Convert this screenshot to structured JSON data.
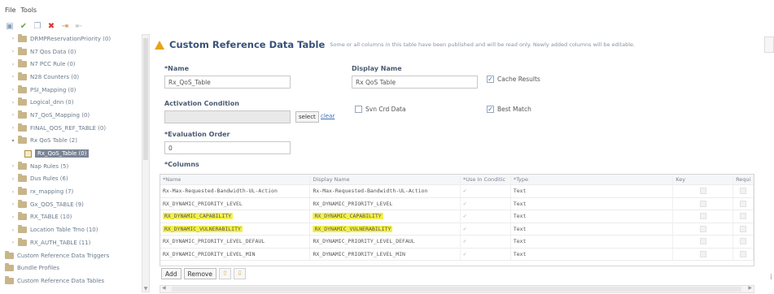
{
  "menu": [
    "File",
    "Tools"
  ],
  "toolbar": {
    "icons": [
      "save-icon",
      "check-icon",
      "copy-icon",
      "delete-icon",
      "export-icon",
      "import-icon"
    ]
  },
  "tree": [
    {
      "label": "DRMPReservationPriority (0)",
      "expanded": false
    },
    {
      "label": "N7 Qos Data (0)",
      "expanded": false
    },
    {
      "label": "N7 PCC Rule (0)",
      "expanded": false
    },
    {
      "label": "N28 Counters (0)",
      "expanded": false
    },
    {
      "label": "PSI_Mapping (0)",
      "expanded": false
    },
    {
      "label": "Logical_dnn (0)",
      "expanded": false
    },
    {
      "label": "N7_QoS_Mapping (0)",
      "expanded": false
    },
    {
      "label": "FINAL_QOS_REF_TABLE (0)",
      "expanded": false
    },
    {
      "label": "Rx QoS Table (2)",
      "expanded": true
    },
    {
      "label": "Rx_QoS_Table (0)",
      "selected": true,
      "child": true
    },
    {
      "label": "Nap Rules (5)",
      "expanded": false
    },
    {
      "label": "Dus Rules (6)",
      "expanded": false
    },
    {
      "label": "rx_mapping (7)",
      "expanded": false
    },
    {
      "label": "Gx_QOS_TABLE (9)",
      "expanded": false
    },
    {
      "label": "RX_TABLE (10)",
      "expanded": false
    },
    {
      "label": "Location Table Trno (10)",
      "expanded": false
    },
    {
      "label": "RX_AUTH_TABLE (11)",
      "expanded": false
    },
    {
      "label": "Custom Reference Data Triggers",
      "root": true
    },
    {
      "label": "Bundle Profiles",
      "root": true
    },
    {
      "label": "Custom Reference Data Tables",
      "root": true
    }
  ],
  "header": {
    "title": "Custom Reference Data Table",
    "notice": "Some or all columns in this table have been published and will be read only.  Newly added columns will be editable."
  },
  "form": {
    "name_label": "*Name",
    "name_value": "Rx_QoS_Table",
    "display_name_label": "Display Name",
    "display_name_value": "Rx QoS Table",
    "cache_results_label": "Cache Results",
    "cache_results_checked": true,
    "activation_label": "Activation Condition",
    "activation_value": "",
    "select_label": "select",
    "clear_label": "clear",
    "svn_label": "Svn Crd Data",
    "svn_checked": false,
    "best_match_label": "Best Match",
    "best_match_checked": true,
    "eval_label": "*Evaluation Order",
    "eval_value": "0",
    "columns_label": "*Columns"
  },
  "grid": {
    "headers": [
      "*Name",
      "Display Name",
      "*Use In Conditic",
      "*Type",
      "Key",
      "Requi"
    ],
    "rows": [
      {
        "name": "Rx-Max-Requested-Bandwidth-UL-Action",
        "display": "Rx-Max-Requested-Bandwidth-UL-Action",
        "use": "✓",
        "type": "Text",
        "highlight": false
      },
      {
        "name": "RX_DYNAMIC_PRIORITY_LEVEL",
        "display": "RX_DYNAMIC_PRIORITY_LEVEL",
        "use": "✓",
        "type": "Text",
        "highlight": false
      },
      {
        "name": "RX_DYNAMIC_CAPABILITY",
        "display": "RX_DYNAMIC_CAPABILITY",
        "use": "✓",
        "type": "Text",
        "highlight": true
      },
      {
        "name": "RX_DYNAMIC_VULNERABILITY",
        "display": "RX_DYNAMIC_VULNERABILITY",
        "use": "✓",
        "type": "Text",
        "highlight": true
      },
      {
        "name": "RX_DYNAMIC_PRIORITY_LEVEL_DEFAUL",
        "display": "RX_DYNAMIC_PRIORITY_LEVEL_DEFAUL",
        "use": "✓",
        "type": "Text",
        "highlight": false
      },
      {
        "name": "RX_DYNAMIC_PRIORITY_LEVEL_MIN",
        "display": "RX_DYNAMIC_PRIORITY_LEVEL_MIN",
        "use": "✓",
        "type": "Text",
        "highlight": false
      }
    ],
    "add_label": "Add",
    "remove_label": "Remove"
  },
  "colors": {
    "title": "#38527a",
    "highlight": "#f4f04a",
    "warning": "#e8a317",
    "selected_tree": "#7a8595"
  }
}
